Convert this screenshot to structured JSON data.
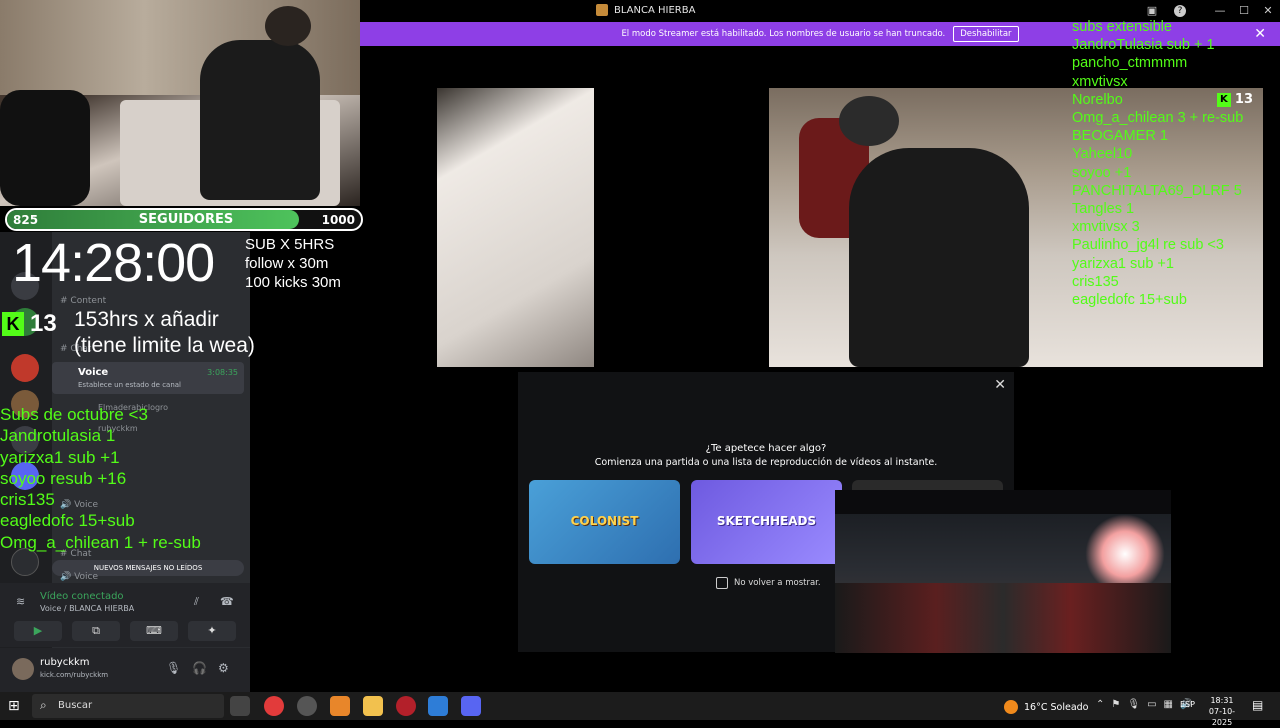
{
  "window": {
    "title": "BLANCA HIERBA",
    "streamer_notice": "El modo Streamer está habilitado. Los nombres de usuario se han truncado.",
    "disable_button": "Deshabilitar"
  },
  "overlay": {
    "followers_current": "825",
    "followers_label": "SEGUIDORES",
    "followers_goal": "1000",
    "followers_progress": 0.825,
    "timer": "14:28:00",
    "sub_rules": [
      "SUB X 5HRS",
      "follow x 30m",
      "100 kicks 30m"
    ],
    "kick_count": "13",
    "hours_line1": "153hrs  x añadir",
    "hours_line2": "(tiene limite la wea)",
    "month_subs": [
      "Subs de octubre <3",
      "Jandrotulasia 1",
      "yarizxa1 sub +1",
      "soyoo resub +16",
      "cris135",
      "eagledofc 15+sub",
      "Omg_a_chilean 1 + re-sub"
    ],
    "extensible_subs": [
      "subs extensible",
      "JandroTulasia sub + 1",
      "pancho_ctmmmm",
      "xmvtivsx",
      "Norelbo",
      "Omg_a_chilean 3 + re-sub",
      "BEOGAMER 1",
      "Yaheel10",
      "soyoo +1",
      "PANCHITALTA69_DLRF 5",
      "Tangles 1",
      "xmvtivsx 3",
      "Paulinho_jg4l  re sub <3",
      "yarizxa1 sub +1",
      "cris135",
      "eagledofc 15+sub"
    ]
  },
  "sidebar": {
    "channels": [
      "Content",
      "Chat"
    ],
    "voice_channel": "Voice",
    "voice_status": "Establece un estado de canal",
    "voice_time": "3:08:35",
    "member1": "Elmaderabiclogro",
    "member2": "rubyckkm",
    "voice2": "Voice",
    "chat2": "Chat",
    "new_messages": "NUEVOS MENSAJES NO LEÍDOS",
    "voice3": "Voice",
    "connected_title": "Vídeo conectado",
    "connected_sub": "Voice / BLANCA HIERBA",
    "username": "rubyckkm",
    "user_status": "kick.com/rubyckkm"
  },
  "tiles": {
    "counter": "13"
  },
  "activity_modal": {
    "question": "¿Te apetece hacer algo?",
    "subtitle": "Comienza una partida o una lista de reproducción de vídeos al instante.",
    "cards": [
      "COLONIST",
      "SKETCHHEADS"
    ],
    "checkbox_label": "No volver a mostrar."
  },
  "taskbar": {
    "search_placeholder": "Buscar",
    "weather": "16°C  Soleado",
    "lang": "ESP",
    "time": "18:31",
    "date": "07-10-2025"
  }
}
